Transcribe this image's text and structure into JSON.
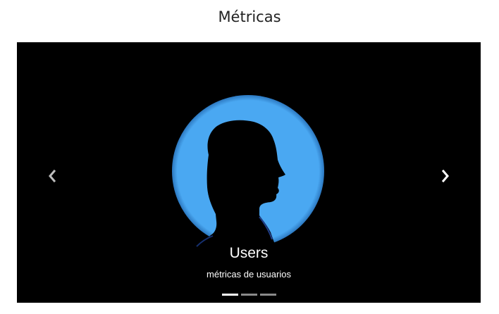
{
  "page": {
    "title": "Métricas"
  },
  "carousel": {
    "slide": {
      "title": "Users",
      "text": "métricas de usuarios"
    },
    "indicators": [
      {
        "active": true
      },
      {
        "active": false
      },
      {
        "active": false
      }
    ],
    "colors": {
      "background": "#000000",
      "circle": "#4aa8f2",
      "indicator_active": "#ffffff",
      "indicator_inactive": "#8a8a8a"
    },
    "icons": {
      "prev": "chevron-left-icon",
      "next": "chevron-right-icon"
    }
  }
}
